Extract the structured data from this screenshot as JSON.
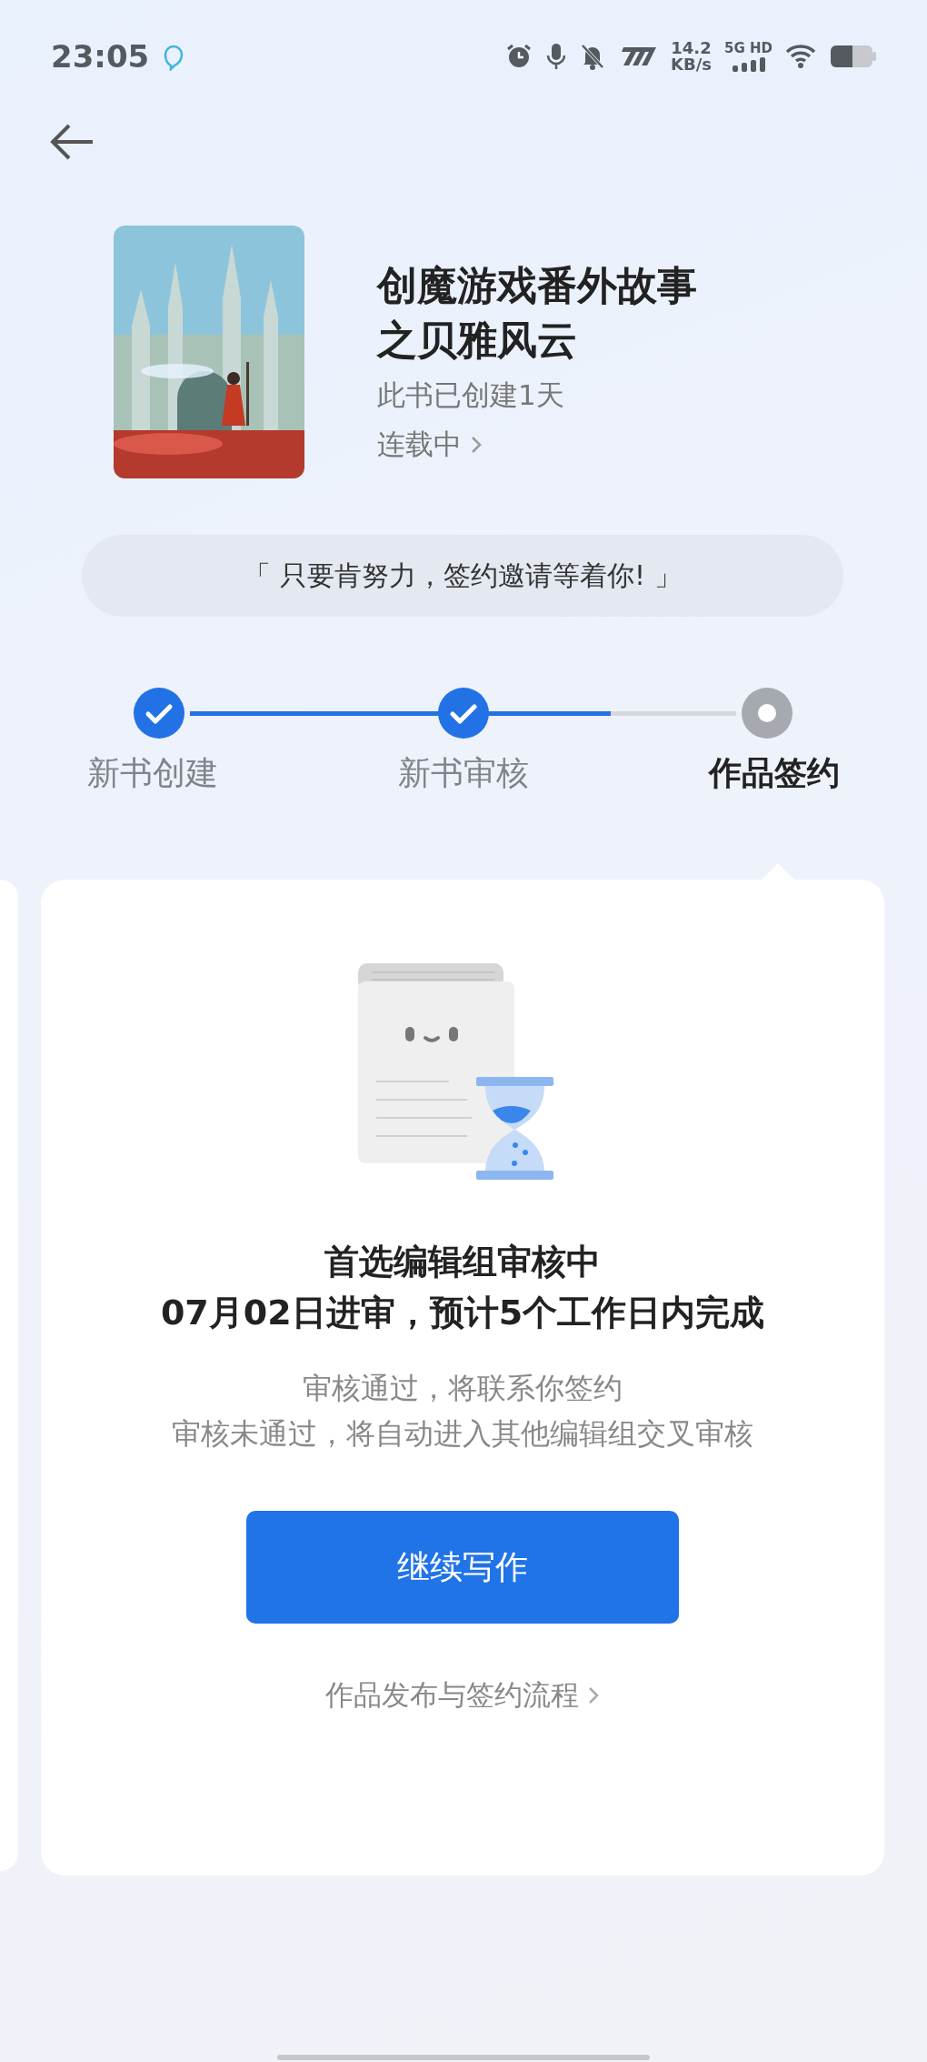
{
  "status_bar": {
    "time": "23:05",
    "speed_value": "14.2",
    "speed_unit": "KB/s",
    "network": "5G HD"
  },
  "book": {
    "title": "创魔游戏番外故事之贝雅风云",
    "created": "此书已创建1天",
    "status": "连载中"
  },
  "motto": "「 只要肯努力，签约邀请等着你! 」",
  "steps": [
    {
      "label": "新书创建",
      "completed": true
    },
    {
      "label": "新书审核",
      "completed": true
    },
    {
      "label": "作品签约",
      "completed": false
    }
  ],
  "progress": {
    "level": 0.77
  },
  "card": {
    "headline": "首选编辑组审核中",
    "schedule": "07月02日进审，预计5个工作日内完成",
    "notes": [
      "审核通过，将联系你签约",
      "审核未通过，将自动进入其他编辑组交叉审核"
    ],
    "button": "继续写作",
    "link": "作品发布与签约流程"
  }
}
